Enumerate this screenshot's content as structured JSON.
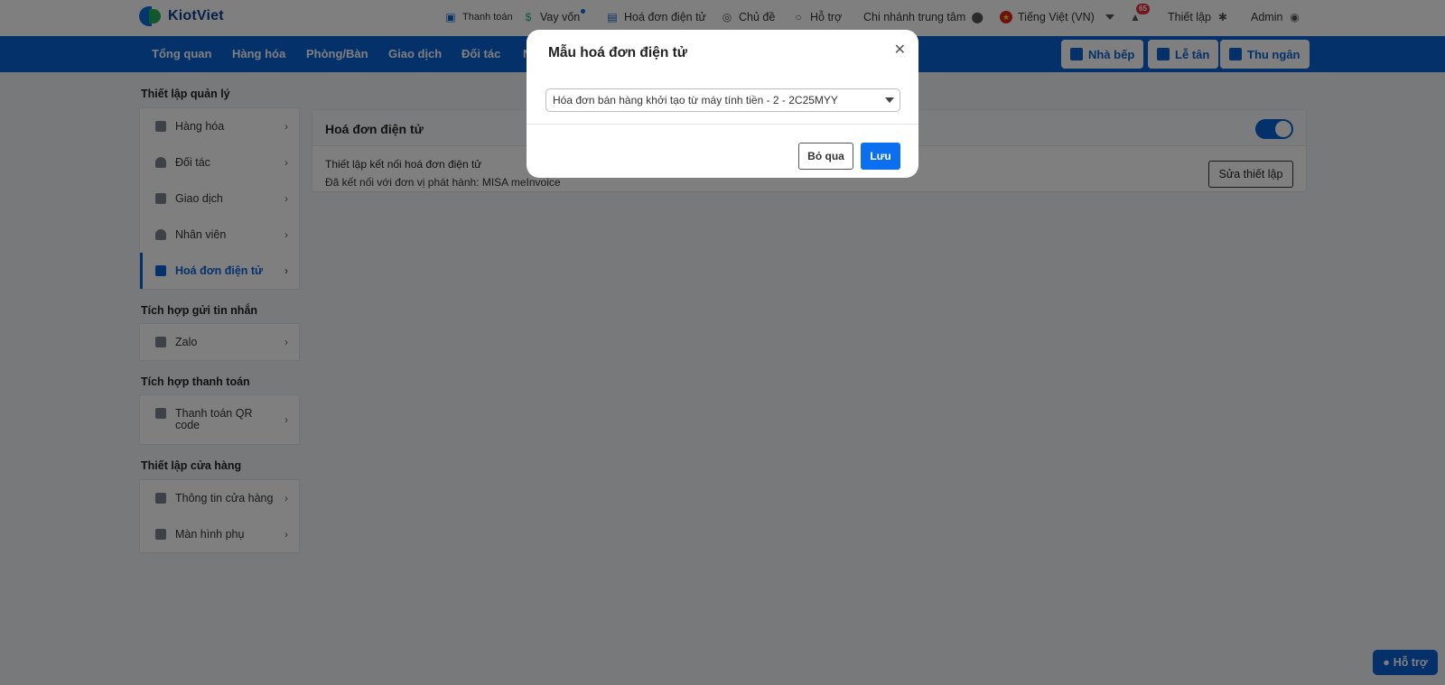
{
  "app": {
    "brand": "KiotViet"
  },
  "topbar": {
    "payment": "Thanh toán",
    "loan": "Vay vốn",
    "einvoice": "Hoá đơn điện tử",
    "theme": "Chủ đề",
    "support": "Hỗ trợ",
    "branch": "Chi nhánh trung tâm",
    "language": "Tiếng Việt (VN)",
    "notifications": "65",
    "settings": "Thiết lập",
    "user": "Admin"
  },
  "nav": {
    "items": [
      "Tổng quan",
      "Hàng hóa",
      "Phòng/Bàn",
      "Giao dịch",
      "Đối tác",
      "N"
    ],
    "buttons": [
      "Nhà bếp",
      "Lễ tân",
      "Thu ngân"
    ]
  },
  "sidebar": {
    "groups": [
      {
        "title": "Thiết lập quản lý",
        "items": [
          "Hàng hóa",
          "Đối tác",
          "Giao dịch",
          "Nhân viên",
          "Hoá đơn điện tử"
        ],
        "active": "Hoá đơn điện tử"
      },
      {
        "title": "Tích hợp gửi tin nhắn",
        "items": [
          "Zalo"
        ]
      },
      {
        "title": "Tích hợp thanh toán",
        "items": [
          "Thanh toán QR code"
        ]
      },
      {
        "title": "Thiết lập cửa hàng",
        "items": [
          "Thông tin cửa hàng",
          "Màn hình phụ"
        ]
      }
    ]
  },
  "main": {
    "card_title": "Hoá đơn điện tử",
    "toggle_on": true,
    "connect_title": "Thiết lập kết nối hoá đơn điện tử",
    "connect_status": "Đã kết nối với đơn vị phát hành: MISA meInvoice",
    "edit_button": "Sửa thiết lập"
  },
  "modal": {
    "title": "Mẫu hoá đơn điện tử",
    "selected_template": "Hóa đơn bán hàng khởi tạo từ máy tính tiền - 2 - 2C25MYY",
    "cancel_label": "Bỏ qua",
    "save_label": "Lưu"
  },
  "help_float": "Hỗ trợ",
  "colors": {
    "primary": "#0b63d6",
    "save": "#0b6ff0",
    "badge": "#e5303b"
  }
}
